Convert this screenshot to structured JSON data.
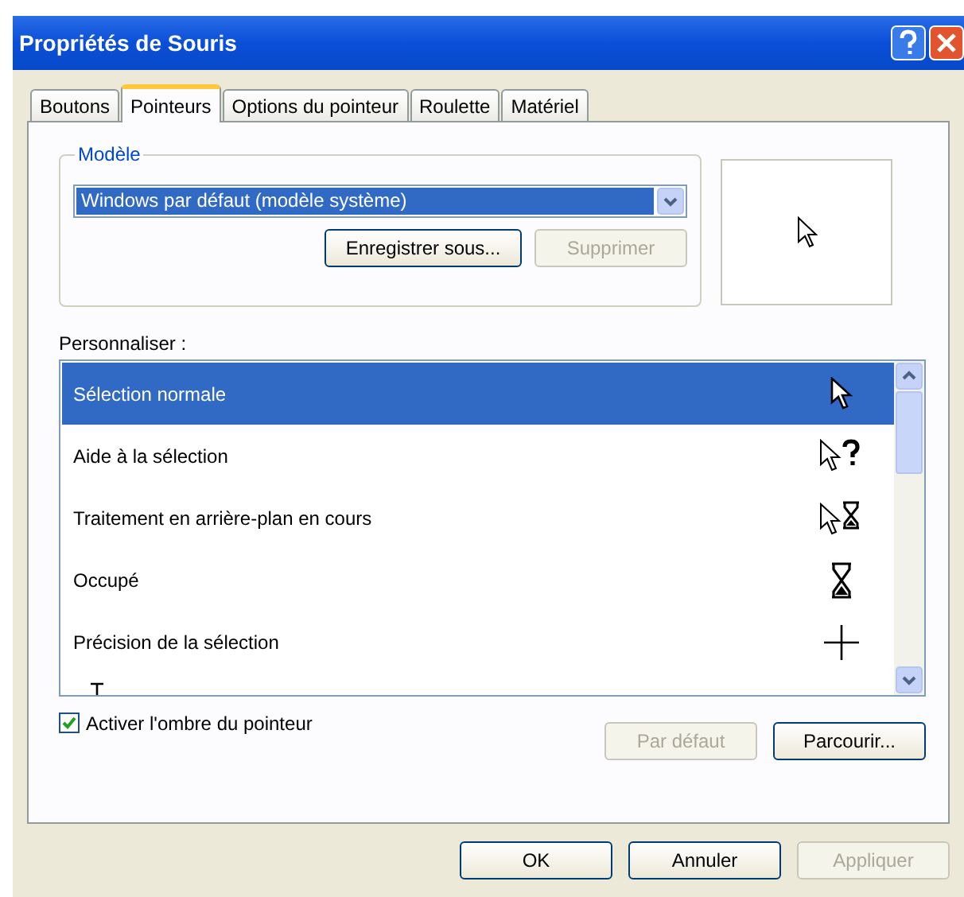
{
  "window": {
    "title": "Propriétés de Souris"
  },
  "tabs": [
    {
      "label": "Boutons",
      "selected": false
    },
    {
      "label": "Pointeurs",
      "selected": true
    },
    {
      "label": "Options du pointeur",
      "selected": false
    },
    {
      "label": "Roulette",
      "selected": false
    },
    {
      "label": "Matériel",
      "selected": false
    }
  ],
  "scheme": {
    "legend": "Modèle",
    "value": "Windows par défaut (modèle système)",
    "buttons": [
      {
        "label": "Enregistrer sous...",
        "disabled": false
      },
      {
        "label": "Supprimer",
        "disabled": true
      }
    ]
  },
  "customize": {
    "label": "Personnaliser :",
    "items": [
      {
        "label": "Sélection normale",
        "kind": "arrow",
        "selected": true
      },
      {
        "label": "Aide à la sélection",
        "kind": "help",
        "selected": false
      },
      {
        "label": "Traitement en arrière-plan en cours",
        "kind": "working",
        "selected": false
      },
      {
        "label": "Occupé",
        "kind": "busy",
        "selected": false
      },
      {
        "label": "Précision de la sélection",
        "kind": "cross",
        "selected": false
      },
      {
        "kind": "text",
        "selected": false
      }
    ]
  },
  "shadow": {
    "label": "Activer l'ombre du pointeur",
    "checked": true
  },
  "list_buttons": [
    {
      "label": "Par défaut",
      "disabled": true
    },
    {
      "label": "Parcourir...",
      "disabled": false
    }
  ],
  "buttons": [
    {
      "label": "OK",
      "disabled": false
    },
    {
      "label": "Annuler",
      "disabled": false
    },
    {
      "label": "Appliquer",
      "disabled": true
    }
  ]
}
